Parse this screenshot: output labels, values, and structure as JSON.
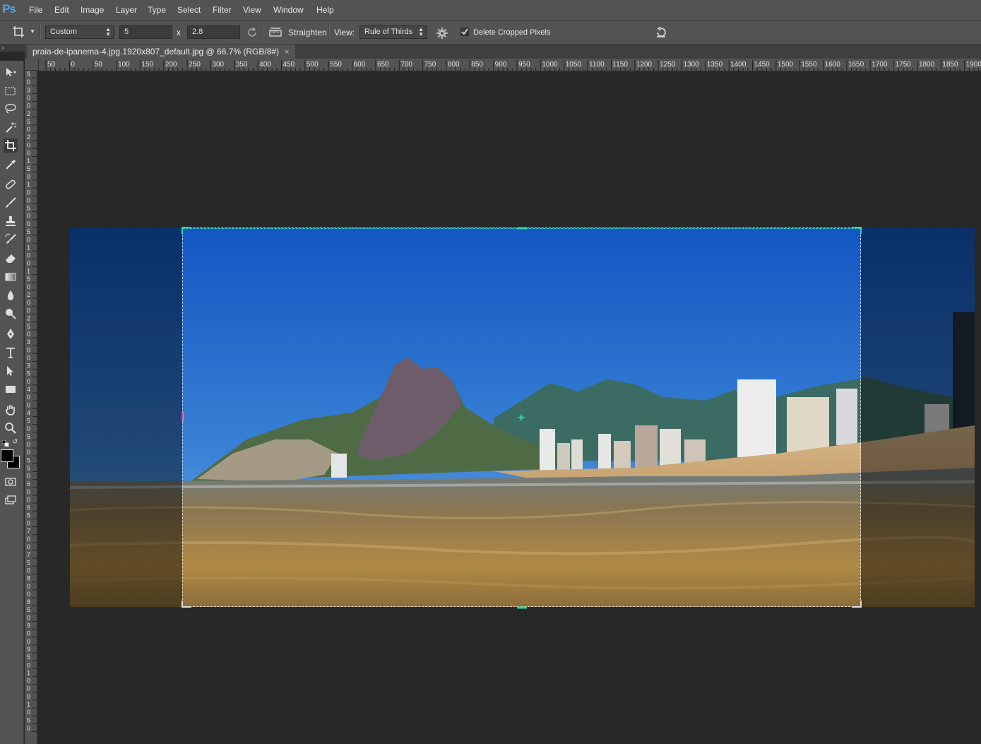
{
  "app": {
    "logo": "Ps"
  },
  "menu": [
    "File",
    "Edit",
    "Image",
    "Layer",
    "Type",
    "Select",
    "Filter",
    "View",
    "Window",
    "Help"
  ],
  "options": {
    "ratio_preset": "Custom",
    "width_value": "5",
    "times_symbol": "x",
    "height_value": "2.8",
    "straighten_label": "Straighten",
    "view_label": "View:",
    "view_value": "Rule of Thirds",
    "delete_cropped_label": "Delete Cropped Pixels",
    "delete_cropped_checked": true
  },
  "document": {
    "tab_title": "praia-de-ipanema-4.jpg.1920x807_default.jpg @ 66.7% (RGB/8#)",
    "close_glyph": "×"
  },
  "rulers": {
    "horizontal": [
      "50",
      "0",
      "50",
      "100",
      "150",
      "200",
      "250",
      "300",
      "350",
      "400",
      "450",
      "500",
      "550",
      "600",
      "650",
      "700",
      "750",
      "800",
      "850",
      "900",
      "950",
      "1000",
      "1050",
      "1100",
      "1150",
      "1200",
      "1250",
      "1300",
      "1350",
      "1400",
      "1450",
      "1500",
      "1550",
      "1600",
      "1650",
      "1700",
      "1750",
      "1800",
      "1850",
      "1900"
    ],
    "vertical": [
      "5",
      "0",
      "3",
      "0",
      "0",
      "2",
      "5",
      "0",
      "2",
      "0",
      "0",
      "1",
      "5",
      "0",
      "1",
      "0",
      "0",
      "5",
      "0",
      "0",
      "5",
      "0",
      "1",
      "0",
      "0",
      "1",
      "5",
      "0",
      "2",
      "0",
      "0",
      "2",
      "5",
      "0",
      "3",
      "0",
      "0",
      "3",
      "5",
      "0",
      "4",
      "0",
      "0",
      "4",
      "5",
      "0",
      "5",
      "0",
      "0",
      "5",
      "5",
      "0",
      "6",
      "0",
      "0",
      "6",
      "5",
      "0",
      "7",
      "0",
      "0",
      "7",
      "5",
      "0",
      "8",
      "0",
      "0",
      "8",
      "5",
      "0",
      "9",
      "0",
      "0",
      "9",
      "5",
      "0",
      "1",
      "0",
      "0",
      "0",
      "1",
      "0",
      "5",
      "0"
    ]
  },
  "tools": [
    "move-tool-icon",
    "marquee-tool-icon",
    "lasso-tool-icon",
    "magic-wand-tool-icon",
    "crop-tool-icon",
    "eyedropper-tool-icon",
    "healing-brush-tool-icon",
    "brush-tool-icon",
    "clone-stamp-tool-icon",
    "history-brush-tool-icon",
    "eraser-tool-icon",
    "gradient-tool-icon",
    "blur-tool-icon",
    "dodge-tool-icon",
    "pen-tool-icon",
    "type-tool-icon",
    "path-selection-tool-icon",
    "rectangle-tool-icon",
    "hand-tool-icon",
    "zoom-tool-icon"
  ],
  "colors": {
    "foreground": "#000000",
    "background": "#ffffff",
    "crop_guide": "#2fd6b0"
  }
}
